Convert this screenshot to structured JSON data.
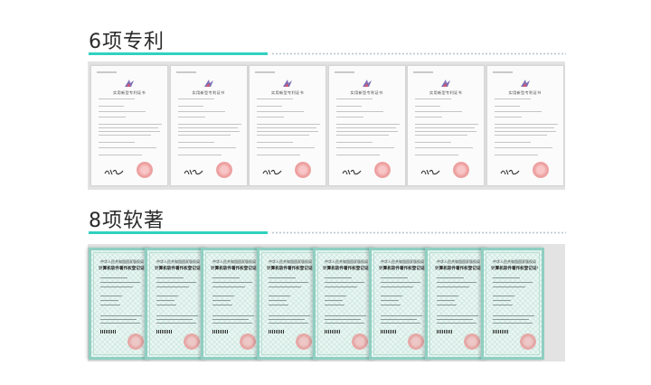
{
  "sections": [
    {
      "title": "6项专利",
      "accent": "#2fd1c0"
    },
    {
      "title": "8项软著",
      "accent": "#2fd1c0"
    }
  ],
  "patent_certificates": {
    "count": 6,
    "title": "实用新型专利证书"
  },
  "software_certificates": {
    "count": 8,
    "line1": "中华人民共和国国家版权局",
    "line2": "计算机软件著作权登记证书"
  },
  "colors": {
    "background": "#ffffff",
    "strip": "#e3e3e3",
    "seal": "#e77b7b",
    "soft_border": "#8fcfc2"
  }
}
